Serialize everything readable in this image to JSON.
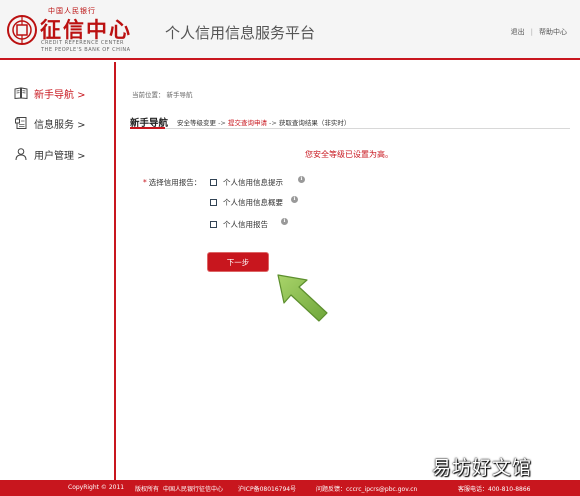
{
  "header": {
    "logo_small": "中国人民银行",
    "logo_big": "征信中心",
    "logo_en_line1": "CREDIT REFERENCE CENTER",
    "logo_en_line2": "THE PEOPLE'S BANK OF CHINA",
    "platform_title": "个人信用信息服务平台",
    "logout": "退出",
    "separator": "|",
    "help": "帮助中心"
  },
  "sidebar": {
    "items": [
      {
        "label": "新手导航 >",
        "icon": "book-icon",
        "active": true
      },
      {
        "label": "信息服务 >",
        "icon": "document-icon",
        "active": false
      },
      {
        "label": "用户管理 >",
        "icon": "user-icon",
        "active": false
      }
    ]
  },
  "main": {
    "breadcrumb_prefix": "当前位置：",
    "breadcrumb_page": "新手导航",
    "steps_title": "新手导航",
    "steps": {
      "s1": "安全等级变更",
      "arrow": "->",
      "s2": "提交查询申请",
      "s3": "获取查询结果（非实时）"
    },
    "notice": "您安全等级已设置为高。",
    "report_label_req": "*",
    "report_label": "选择信用报告：",
    "options": [
      {
        "label": "个人信用信息提示",
        "checked": false
      },
      {
        "label": "个人信用信息概要",
        "checked": false
      },
      {
        "label": "个人信用报告",
        "checked": false
      }
    ],
    "next_button": "下一步"
  },
  "footer": {
    "copyright": "CopyRight © 2011",
    "rights": "版权所有",
    "org": "中国人民银行征信中心",
    "icp": "沪ICP备08016794号",
    "feedback": "问题反馈：cccrc_ipcrs@pbc.gov.cn",
    "hotline": "客服电话：400-810-8866"
  },
  "watermark": "易坊好文馆",
  "colors": {
    "accent": "#c8161e",
    "arrow_green": "#8cc152"
  }
}
